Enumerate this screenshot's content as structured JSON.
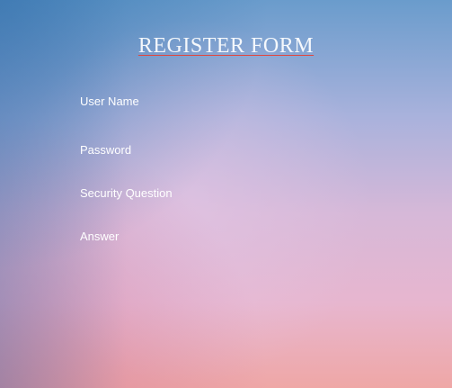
{
  "form": {
    "title": "REGISTER FORM",
    "fields": [
      {
        "label": "User Name",
        "value": ""
      },
      {
        "label": "Password",
        "value": ""
      },
      {
        "label": "Security Question",
        "value": ""
      },
      {
        "label": "Answer",
        "value": ""
      }
    ]
  },
  "colors": {
    "title_underline": "#e0473f",
    "text": "#ffffff",
    "background_top": "#6a9ccc",
    "background_bottom": "#efa7a6"
  }
}
